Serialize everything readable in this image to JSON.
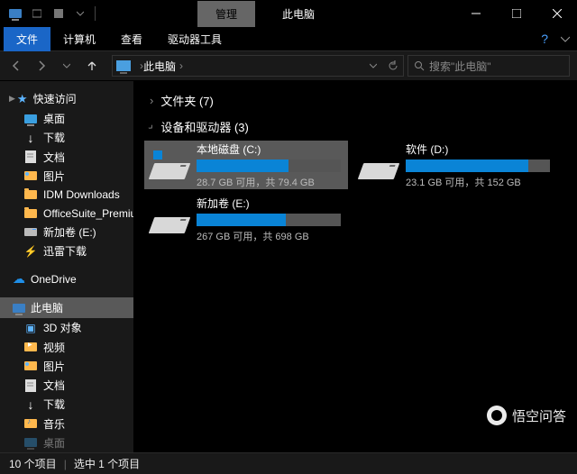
{
  "window": {
    "manage_tab": "管理",
    "title": "此电脑"
  },
  "ribbon": {
    "tabs": [
      "文件",
      "计算机",
      "查看",
      "驱动器工具"
    ],
    "active_index": 0
  },
  "address": {
    "location": "此电脑",
    "search_placeholder": "搜索\"此电脑\""
  },
  "sidebar": {
    "quick_access": {
      "label": "快速访问",
      "items": [
        {
          "label": "桌面",
          "icon": "desktop"
        },
        {
          "label": "下载",
          "icon": "download"
        },
        {
          "label": "文档",
          "icon": "doc"
        },
        {
          "label": "图片",
          "icon": "img"
        },
        {
          "label": "IDM Downloads",
          "icon": "folder"
        },
        {
          "label": "OfficeSuite_Premium",
          "icon": "folder"
        },
        {
          "label": "新加卷 (E:)",
          "icon": "drive"
        },
        {
          "label": "迅雷下载",
          "icon": "thunder"
        }
      ]
    },
    "onedrive": {
      "label": "OneDrive"
    },
    "this_pc": {
      "label": "此电脑",
      "items": [
        {
          "label": "3D 对象",
          "icon": "cube"
        },
        {
          "label": "视频",
          "icon": "video"
        },
        {
          "label": "图片",
          "icon": "img"
        },
        {
          "label": "文档",
          "icon": "doc"
        },
        {
          "label": "下载",
          "icon": "download"
        },
        {
          "label": "音乐",
          "icon": "music"
        },
        {
          "label": "桌面",
          "icon": "desktop"
        }
      ]
    }
  },
  "main": {
    "folders_header": "文件夹 (7)",
    "drives_header": "设备和驱动器 (3)",
    "drives": [
      {
        "name": "本地磁盘 (C:)",
        "status": "28.7 GB 可用，共 79.4 GB",
        "fill_pct": 64,
        "selected": true,
        "flag_color": "#0a84d6"
      },
      {
        "name": "软件 (D:)",
        "status": "23.1 GB 可用，共 152 GB",
        "fill_pct": 85,
        "selected": false,
        "flag_color": ""
      },
      {
        "name": "新加卷 (E:)",
        "status": "267 GB 可用，共 698 GB",
        "fill_pct": 62,
        "selected": false,
        "flag_color": ""
      }
    ]
  },
  "statusbar": {
    "item_count": "10 个项目",
    "selected": "选中 1 个项目"
  },
  "watermark": "悟空问答"
}
